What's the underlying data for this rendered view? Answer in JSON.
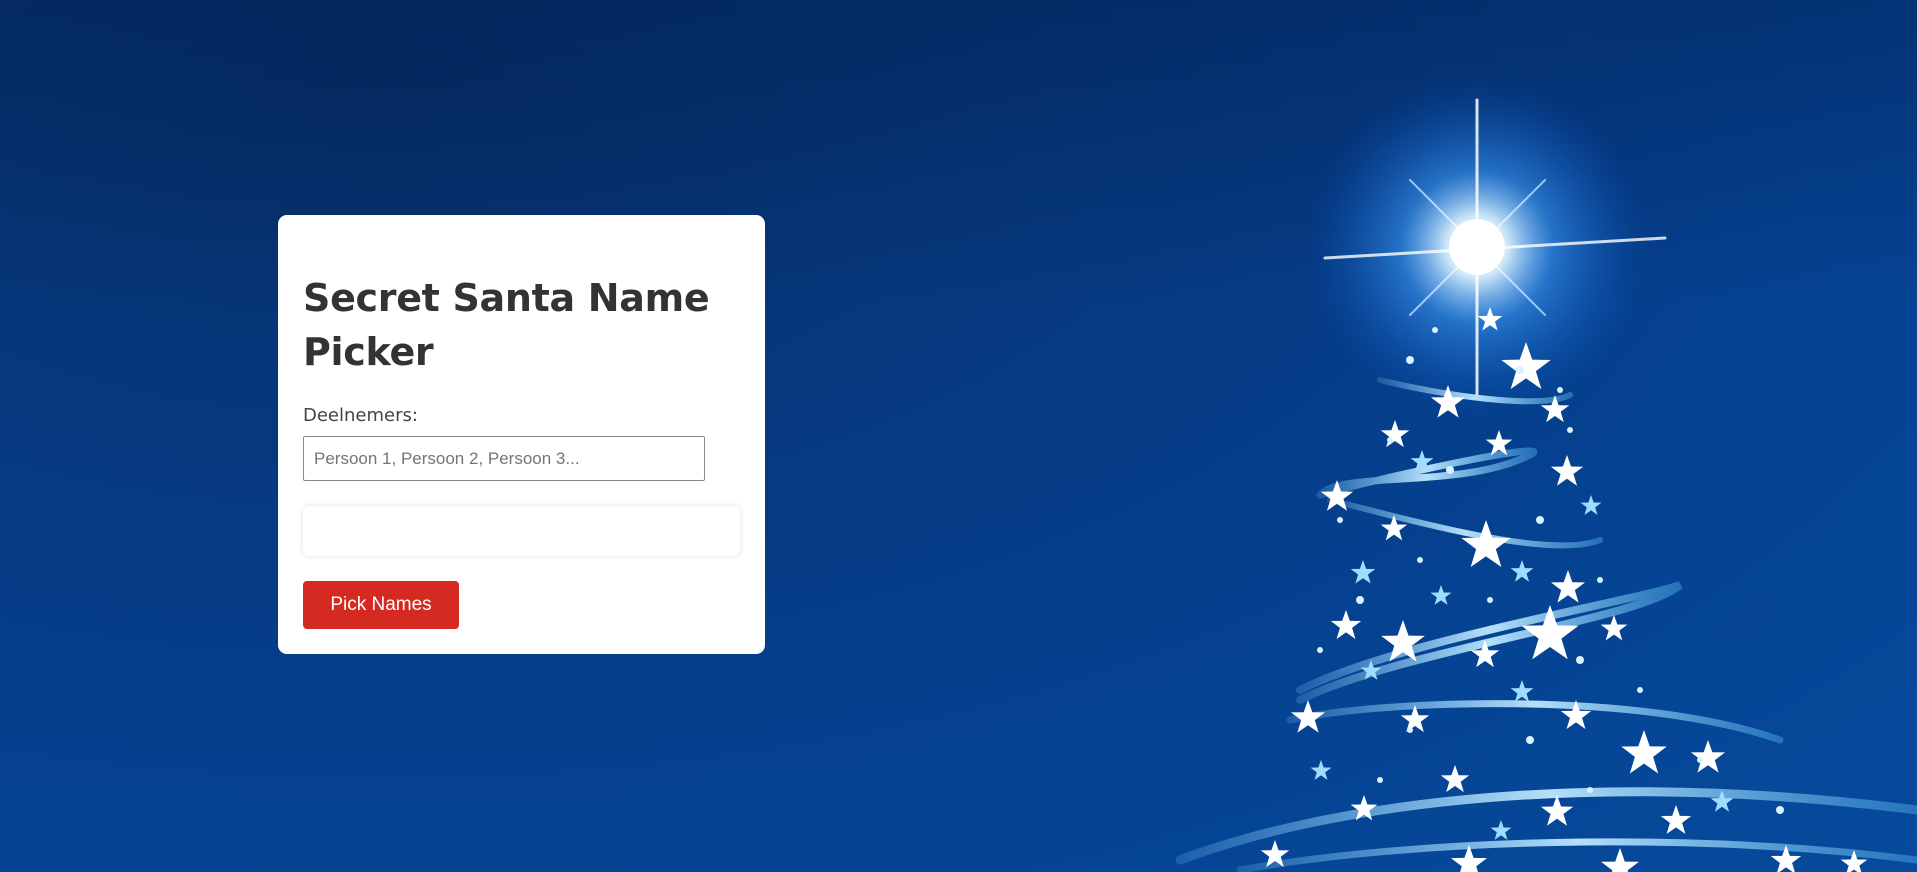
{
  "app": {
    "title": "Secret Santa Name Picker"
  },
  "form": {
    "participants_label": "Deelnemers:",
    "participants_placeholder": "Persoon 1, Persoon 2, Persoon 3...",
    "participants_value": "",
    "results_text": "",
    "pick_button_label": "Pick Names"
  },
  "colors": {
    "background": "#054393",
    "card": "#ffffff",
    "button": "#d42a22",
    "title_text": "#333333"
  },
  "icons": {
    "background_art": "christmas-tree-stars"
  }
}
